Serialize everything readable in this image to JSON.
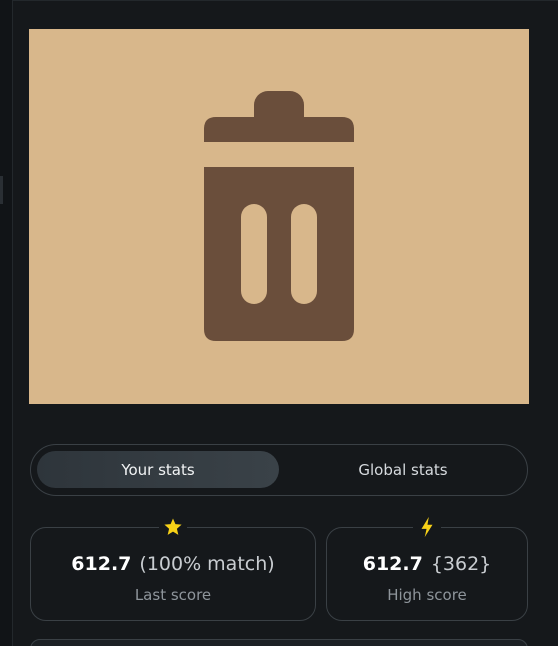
{
  "preview": {
    "icon": "trash-can-icon",
    "background_color": "#d8b78b",
    "icon_color": "#6a4e3b"
  },
  "stats_toggle": {
    "your_stats_label": "Your stats",
    "global_stats_label": "Global stats",
    "selected": "Your stats"
  },
  "last_score": {
    "icon": "star-icon",
    "icon_color": "#f7d117",
    "value": "612.7",
    "extra": "(100% match)",
    "label": "Last score"
  },
  "high_score": {
    "icon": "lightning-icon",
    "icon_color": "#f7d117",
    "value": "612.7",
    "extra": "{362}",
    "label": "High score"
  }
}
